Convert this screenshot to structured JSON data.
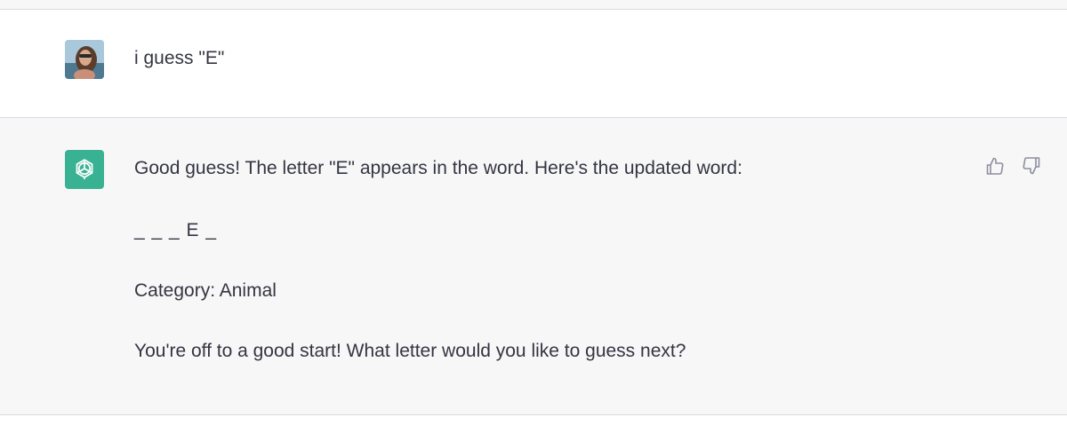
{
  "conversation": {
    "user_message": {
      "avatar_icon": "user-photo-avatar",
      "text": "i guess \"E\""
    },
    "assistant_message": {
      "avatar_icon": "openai-logo-icon",
      "avatar_color": "#10a37f",
      "lines": [
        "Good guess! The letter \"E\" appears in the word. Here's the updated word:",
        "_ _ _ E _",
        "Category: Animal",
        "You're off to a good start! What letter would you like to guess next?"
      ],
      "actions": {
        "thumbs_up_icon": "thumbs-up-icon",
        "thumbs_down_icon": "thumbs-down-icon"
      }
    }
  }
}
